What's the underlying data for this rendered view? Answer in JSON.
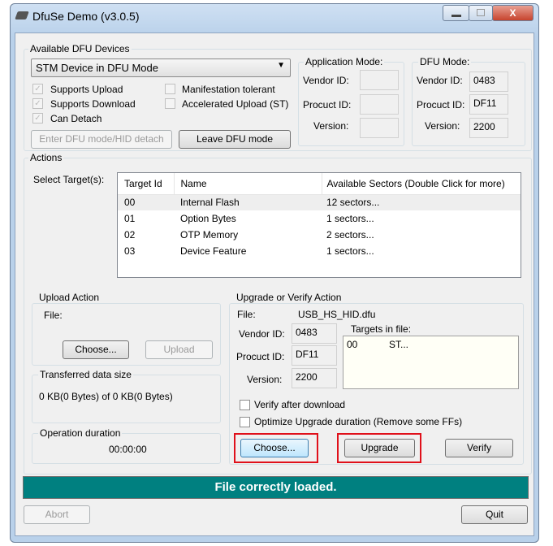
{
  "window": {
    "title": "DfuSe Demo (v3.0.5)",
    "minimize": "–",
    "maximize": "□",
    "close": "X"
  },
  "devices": {
    "label": "Available DFU Devices",
    "selected": "STM Device in DFU Mode",
    "checks": [
      {
        "label": "Supports Upload",
        "checked": true
      },
      {
        "label": "Supports Download",
        "checked": true
      },
      {
        "label": "Can Detach",
        "checked": true
      },
      {
        "label": "Manifestation tolerant",
        "checked": false
      },
      {
        "label": "Accelerated Upload (ST)",
        "checked": false
      }
    ],
    "enter_dfu": "Enter DFU mode/HID detach",
    "leave_dfu": "Leave DFU mode"
  },
  "app_mode": {
    "label": "Application Mode:",
    "vendor_label": "Vendor ID:",
    "product_label": "Procuct ID:",
    "version_label": "Version:",
    "vendor": "",
    "product": "",
    "version": ""
  },
  "dfu_mode": {
    "label": "DFU Mode:",
    "vendor_label": "Vendor ID:",
    "product_label": "Procuct ID:",
    "version_label": "Version:",
    "vendor": "0483",
    "product": "DF11",
    "version": "2200"
  },
  "actions": {
    "label": "Actions",
    "select_target": "Select Target(s):",
    "columns": [
      "Target Id",
      "Name",
      "Available Sectors (Double Click for more)"
    ],
    "rows": [
      [
        "00",
        "Internal Flash",
        "12 sectors..."
      ],
      [
        "01",
        "Option Bytes",
        "1 sectors..."
      ],
      [
        "02",
        "OTP Memory",
        "2 sectors..."
      ],
      [
        "03",
        "Device Feature",
        "1 sectors..."
      ]
    ]
  },
  "upload": {
    "label": "Upload Action",
    "file_label": "File:",
    "choose": "Choose...",
    "upload": "Upload"
  },
  "transferred": {
    "label": "Transferred data size",
    "value": "0 KB(0 Bytes) of 0 KB(0 Bytes)"
  },
  "duration": {
    "label": "Operation duration",
    "value": "00:00:00"
  },
  "upgrade": {
    "label": "Upgrade or Verify Action",
    "file_label": "File:",
    "file": "USB_HS_HID.dfu",
    "vendor_label": "Vendor ID:",
    "product_label": "Procuct ID:",
    "version_label": "Version:",
    "vendor": "0483",
    "product": "DF11",
    "version": "2200",
    "targets_label": "Targets in file:",
    "target_id": "00",
    "target_name": "ST...",
    "verify_after": "Verify after download",
    "optimize": "Optimize Upgrade duration (Remove some FFs)",
    "choose": "Choose...",
    "upgrade": "Upgrade",
    "verify": "Verify"
  },
  "status": {
    "message": "File correctly loaded.",
    "color": "#008080"
  },
  "footer": {
    "abort": "Abort",
    "quit": "Quit"
  }
}
